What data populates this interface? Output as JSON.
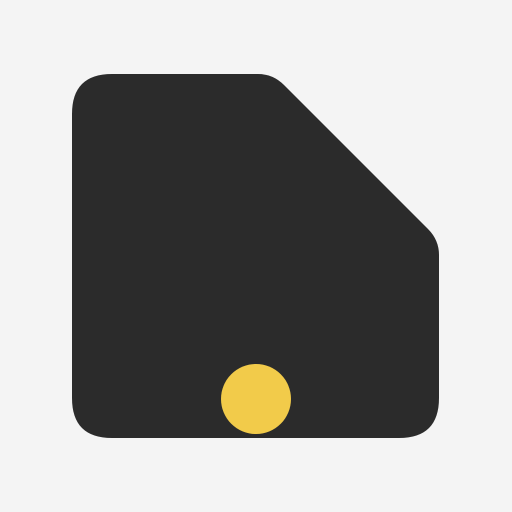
{
  "icon": {
    "name": "folded-corner-card-with-yellow-dot",
    "colors": {
      "background": "#f4f4f4",
      "shape": "#2b2b2b",
      "dot": "#f2cb4a"
    }
  }
}
